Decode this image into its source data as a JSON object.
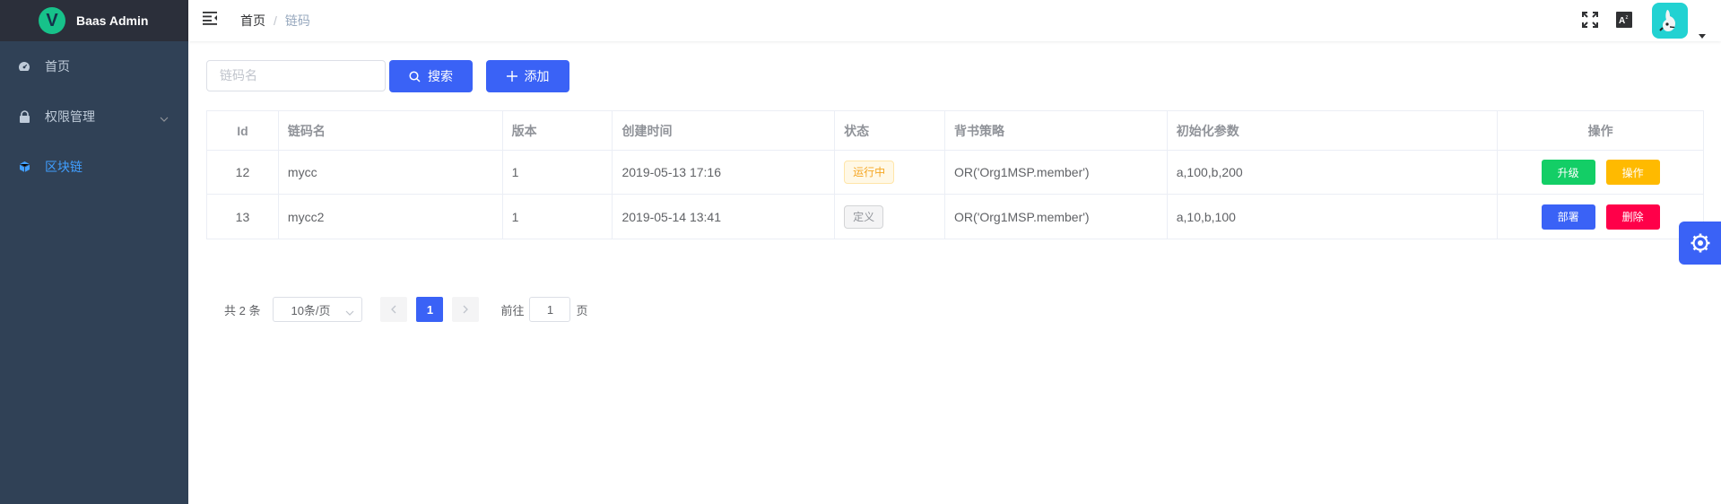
{
  "app": {
    "title": "Baas Admin",
    "logo_letter": "V"
  },
  "sidebar": {
    "items": [
      {
        "label": "首页",
        "icon": "dashboard-icon"
      },
      {
        "label": "权限管理",
        "icon": "lock-icon"
      },
      {
        "label": "区块链",
        "icon": "cube-icon"
      }
    ],
    "active_index": 2
  },
  "header": {
    "breadcrumb": [
      "首页",
      "链码"
    ],
    "separator": "/"
  },
  "toolbar": {
    "search_placeholder": "链码名",
    "search_label": "搜索",
    "add_label": "添加"
  },
  "table": {
    "columns": [
      "Id",
      "链码名",
      "版本",
      "创建时间",
      "状态",
      "背书策略",
      "初始化参数",
      "操作"
    ],
    "rows": [
      {
        "id": "12",
        "name": "mycc",
        "version": "1",
        "created": "2019-05-13 17:16",
        "status": "运行中",
        "policy": "OR('Org1MSP.member')",
        "args": "a,100,b,200",
        "actions": [
          "升级",
          "操作"
        ]
      },
      {
        "id": "13",
        "name": "mycc2",
        "version": "1",
        "created": "2019-05-14 13:41",
        "status": "定义",
        "policy": "OR('Org1MSP.member')",
        "args": "a,10,b,100",
        "actions": [
          "部署",
          "删除"
        ]
      }
    ]
  },
  "pagination": {
    "total_text": "共 2 条",
    "page_size": "10条/页",
    "current_page": "1",
    "goto_label": "前往",
    "goto_value": "1",
    "page_suffix": "页"
  },
  "colors": {
    "primary": "#3a62f6",
    "success": "#13ce66",
    "warning": "#ffba00",
    "danger": "#ff0049",
    "sidebar_bg": "#304156",
    "sidebar_active": "#409eff"
  }
}
